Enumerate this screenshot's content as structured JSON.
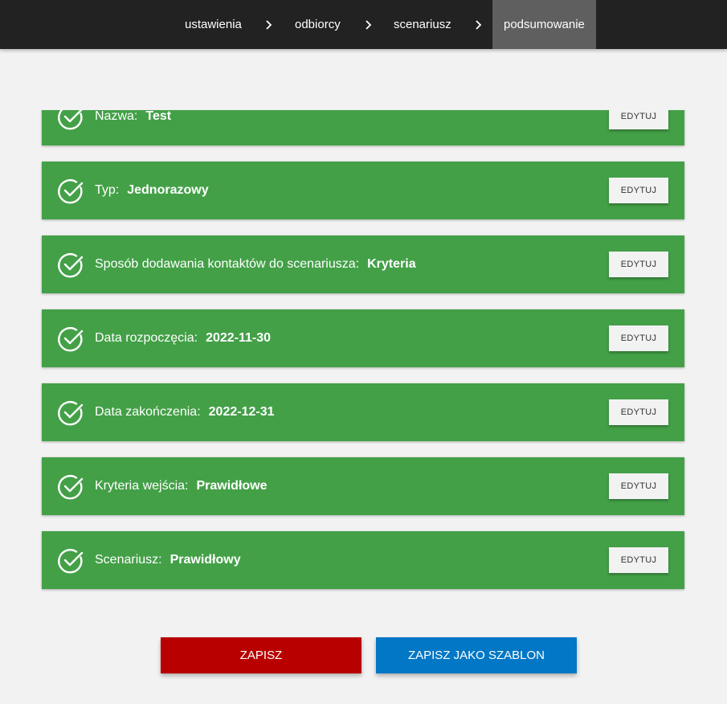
{
  "steps": [
    {
      "label": "ustawienia",
      "active": false
    },
    {
      "label": "odbiorcy",
      "active": false
    },
    {
      "label": "scenariusz",
      "active": false
    },
    {
      "label": "podsumowanie",
      "active": true
    }
  ],
  "icons": {
    "separator": "chevron-right-icon",
    "status": "check-circle-icon"
  },
  "summary": {
    "edit_label": "EDYTUJ",
    "items": [
      {
        "label": "Nazwa:",
        "value": "Test"
      },
      {
        "label": "Typ:",
        "value": "Jednorazowy"
      },
      {
        "label": "Sposób dodawania kontaktów do scenariusza:",
        "value": "Kryteria"
      },
      {
        "label": "Data rozpoczęcia:",
        "value": "2022-11-30"
      },
      {
        "label": "Data zakończenia:",
        "value": "2022-12-31"
      },
      {
        "label": "Kryteria wejścia:",
        "value": "Prawidłowe"
      },
      {
        "label": "Scenariusz:",
        "value": "Prawidłowy"
      }
    ]
  },
  "actions": {
    "save_label": "ZAPISZ",
    "save_template_label": "ZAPISZ JAKO SZABLON"
  },
  "colors": {
    "topbar": "#222222",
    "active_step": "#5f5f5f",
    "card": "#43a047",
    "save": "#b80000",
    "save_template": "#0277c5",
    "background": "#f2f2f2"
  }
}
